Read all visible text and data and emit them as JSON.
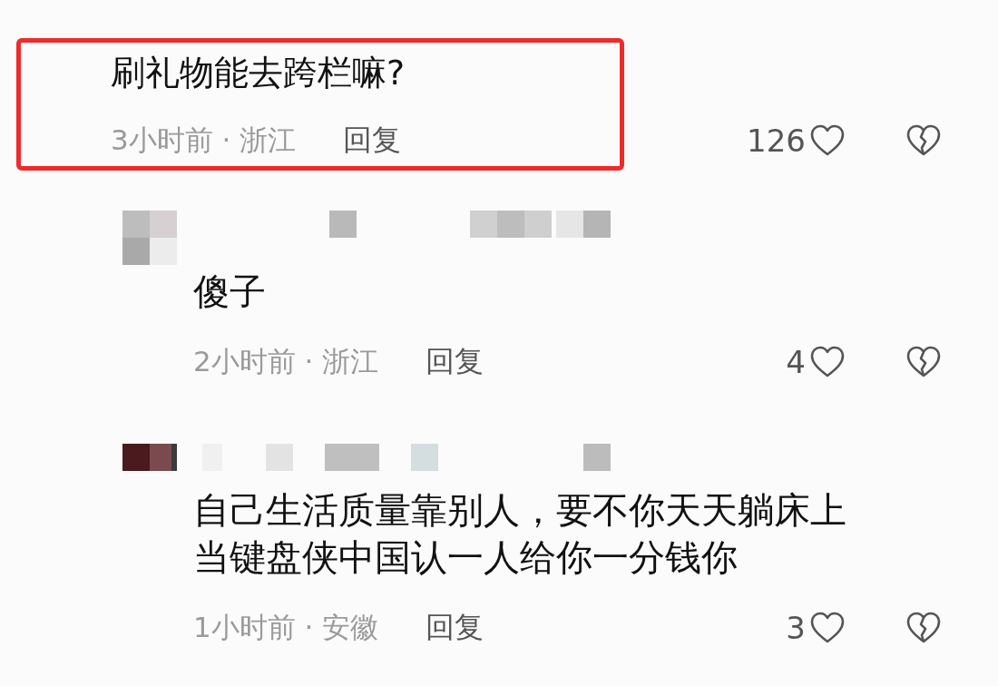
{
  "comments": [
    {
      "kind": "top",
      "highlighted": true,
      "lines": [
        "刷礼物能去跨栏嘛?"
      ],
      "time": "3小时前 · 浙江",
      "reply": "回复",
      "likes": "126"
    },
    {
      "kind": "reply",
      "highlighted": false,
      "lines": [
        "傻子"
      ],
      "time": "2小时前 · 浙江",
      "reply": "回复",
      "likes": "4"
    },
    {
      "kind": "reply",
      "highlighted": false,
      "lines": [
        "自己生活质量靠别人，要不你天天躺床上",
        "当键盘侠中国认一人给你一分钱你"
      ],
      "time": "1小时前 · 安徽",
      "reply": "回复",
      "likes": "3"
    }
  ]
}
